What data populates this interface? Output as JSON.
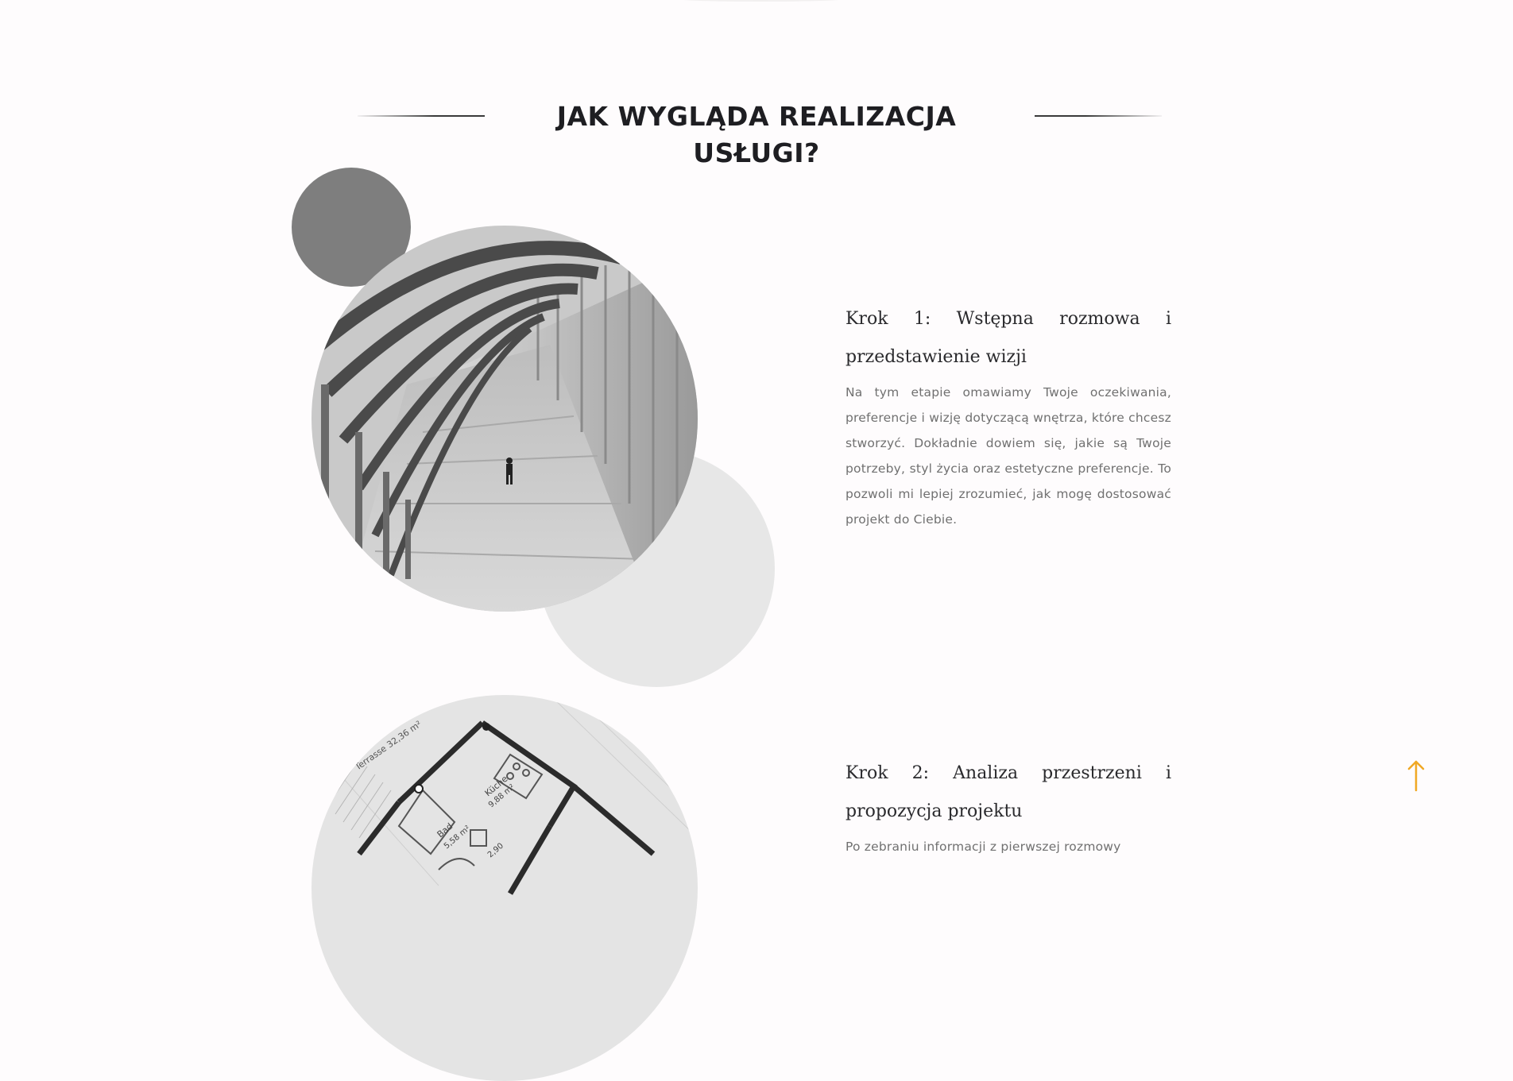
{
  "section": {
    "title": "JAK WYGLĄDA REALIZACJA USŁUGI?"
  },
  "steps": [
    {
      "title": "Krok 1: Wstępna rozmowa i przedstawienie wizji",
      "text": "Na tym etapie omawiamy Twoje oczekiwania, preferencje i wizję dotyczącą wnętrza, które chcesz stworzyć. Dokładnie dowiem się, jakie są Twoje potrzeby, styl życia oraz estetyczne preferencje. To pozwoli mi lepiej zrozumieć, jak mogę dostosować projekt do Ciebie.",
      "image_icon": "tunnel-photo"
    },
    {
      "title": "Krok 2: Analiza przestrzeni i propozycja projektu",
      "text": "Po zebraniu informacji z pierwszej rozmowy",
      "image_icon": "floor-plan-photo",
      "plan_labels": {
        "terrace": "Terrasse 32,36 m²",
        "kitchen": "Küche",
        "kitchen_area": "9,88 m²",
        "bath": "Bad",
        "bath_area": "5,58 m²",
        "dim": "2,90"
      }
    }
  ],
  "back_to_top": {
    "icon": "arrow-up-icon",
    "color": "#f0a824"
  },
  "colors": {
    "background": "#fefcfd",
    "title": "#1e1e22",
    "dark_circle": "#7e7e7e",
    "light_circle": "#e7e7e7",
    "body_text": "#707070"
  }
}
